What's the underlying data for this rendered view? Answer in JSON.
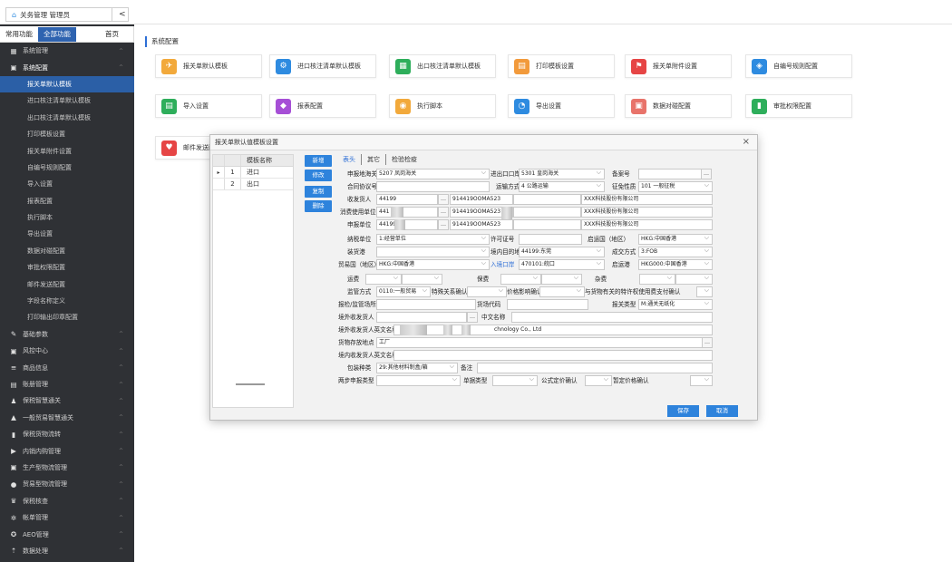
{
  "app": {
    "title": "关务管理 管理员",
    "collapse": "<"
  },
  "sidebar": {
    "tabs": [
      "常用功能",
      "全部功能",
      "首页"
    ],
    "items": [
      {
        "label": "系统管理",
        "icon": "grid-icon",
        "level": 1,
        "chev": "^"
      },
      {
        "label": "系统配置",
        "icon": "checkbox-icon",
        "level": 1,
        "chev": "^",
        "open": true
      },
      {
        "label": "报关单默认模板",
        "level": 2,
        "active": true
      },
      {
        "label": "进口核注清单默认模板",
        "level": 2
      },
      {
        "label": "出口核注清单默认模板",
        "level": 2
      },
      {
        "label": "打印模板设置",
        "level": 2
      },
      {
        "label": "报关单附件设置",
        "level": 2
      },
      {
        "label": "自编号规则配置",
        "level": 2
      },
      {
        "label": "导入设置",
        "level": 2
      },
      {
        "label": "报表配置",
        "level": 2
      },
      {
        "label": "执行脚本",
        "level": 2
      },
      {
        "label": "导出设置",
        "level": 2
      },
      {
        "label": "数据对碰配置",
        "level": 2
      },
      {
        "label": "审批权限配置",
        "level": 2
      },
      {
        "label": "邮件发送配置",
        "level": 2
      },
      {
        "label": "字段名称定义",
        "level": 2
      },
      {
        "label": "打印输出印章配置",
        "level": 2
      },
      {
        "label": "基础参数",
        "icon": "pin-icon",
        "level": 1,
        "chev": "^"
      },
      {
        "label": "风控中心",
        "icon": "checkbox-icon",
        "level": 1,
        "chev": "^"
      },
      {
        "label": "商品信息",
        "icon": "list-icon",
        "level": 1,
        "chev": "^"
      },
      {
        "label": "账册管理",
        "icon": "book-icon",
        "level": 1,
        "chev": "^"
      },
      {
        "label": "保税智慧通关",
        "icon": "user-icon",
        "level": 1,
        "chev": "^"
      },
      {
        "label": "一般贸易智慧通关",
        "icon": "factory-icon",
        "level": 1,
        "chev": "^"
      },
      {
        "label": "保税货物流转",
        "icon": "box-icon",
        "level": 1,
        "chev": "^"
      },
      {
        "label": "内销内购管理",
        "icon": "truck-icon",
        "level": 1,
        "chev": "^"
      },
      {
        "label": "生产型物流管理",
        "icon": "checkbox-icon",
        "level": 1,
        "chev": "^"
      },
      {
        "label": "贸易型物流管理",
        "icon": "circle-icon",
        "level": 1,
        "chev": "^"
      },
      {
        "label": "保税核查",
        "icon": "trophy-icon",
        "level": 1,
        "chev": "^"
      },
      {
        "label": "帐单管理",
        "icon": "gear-icon",
        "level": 1,
        "chev": "^"
      },
      {
        "label": "AEO管理",
        "icon": "shield-icon",
        "level": 1,
        "chev": "^"
      },
      {
        "label": "数据处理",
        "icon": "upload-icon",
        "level": 1,
        "chev": "^"
      }
    ]
  },
  "main": {
    "section": "系统配置",
    "cards": [
      {
        "label": "报关单默认模板",
        "color": "#f2a93b",
        "icon": "plane-icon",
        "glyph": "✈"
      },
      {
        "label": "进口核注清单默认模板",
        "color": "#2e8be0",
        "icon": "share-icon",
        "glyph": "⚙"
      },
      {
        "label": "出口核注清单默认模板",
        "color": "#2eae5b",
        "icon": "grid-icon",
        "glyph": "▦"
      },
      {
        "label": "打印模板设置",
        "color": "#f29a3b",
        "icon": "printer-icon",
        "glyph": "▤"
      },
      {
        "label": "报关单附件设置",
        "color": "#e64545",
        "icon": "flag-icon",
        "glyph": "⚑"
      },
      {
        "label": "自编号规则配置",
        "color": "#2e8be0",
        "icon": "layers-icon",
        "glyph": "◈"
      },
      {
        "label": "导入设置",
        "color": "#2eae5b",
        "icon": "document-icon",
        "glyph": "▤"
      },
      {
        "label": "报表配置",
        "color": "#a64fd6",
        "icon": "tag-icon",
        "glyph": "◆"
      },
      {
        "label": "执行脚本",
        "color": "#f2a93b",
        "icon": "search-user-icon",
        "glyph": "◉"
      },
      {
        "label": "导出设置",
        "color": "#2e8be0",
        "icon": "compass-icon",
        "glyph": "◔"
      },
      {
        "label": "数据对碰配置",
        "color": "#e8736a",
        "icon": "cube-icon",
        "glyph": "▣"
      },
      {
        "label": "审批权限配置",
        "color": "#2eae5b",
        "icon": "book-icon",
        "glyph": "▮"
      },
      {
        "label": "邮件发送配置",
        "color": "#e64545",
        "icon": "heart-icon",
        "glyph": "♥"
      }
    ]
  },
  "dialog": {
    "title": "报关单默认值模板设置",
    "close": "×",
    "list_header": "模板名称",
    "rows": [
      {
        "idx": "1",
        "name": "进口",
        "mark": "▸"
      },
      {
        "idx": "2",
        "name": "出口",
        "mark": ""
      }
    ],
    "buttons": [
      "新增",
      "修改",
      "复制",
      "删除"
    ],
    "tabs": [
      "表头",
      "其它",
      "检验检疫"
    ],
    "save": "保存",
    "cancel": "取消",
    "form": {
      "l_port": "申报地海关",
      "v_port": "5207 凤岗海关",
      "l_ieport": "进出口口岸",
      "v_ieport": "5301 皇岗海关",
      "l_record": "备案号",
      "l_contract": "合同协议号",
      "l_transport": "运输方式",
      "v_transport": "4 公路运输",
      "l_tax": "征免性质",
      "v_tax": "101 一般征税",
      "l_consignee": "收发货人",
      "v_consignee_code": "44199",
      "v_consignee_credit": "914419OOMA523",
      "v_consignee_name": "XXX科技股份有限公司",
      "l_user": "消费使用单位",
      "v_user_code": "441",
      "v_user_credit": "914419OOMA523",
      "v_user_name": "XXX科技股份有限公司",
      "l_declarant": "申报单位",
      "v_declarant_code": "44199",
      "v_declarant_credit": "914419OOMA523",
      "v_declarant_name": "XXX科技股份有限公司",
      "l_taxunit": "纳税单位",
      "v_taxunit": "1:经营单位",
      "l_license": "许可证号",
      "l_origin": "启运国（地区）",
      "v_origin": "HKG:中国香港",
      "l_loadport": "装货港",
      "l_dest": "境内目的地",
      "v_dest": "44199:东莞",
      "l_deal": "成交方式",
      "v_deal": "3:FOB",
      "l_trade": "贸易国（地区）",
      "v_trade": "HKG:中国香港",
      "l_entry": "入境口岸",
      "v_entry": "470101:皖口",
      "l_depport": "启运港",
      "v_depport": "HKG000:中国香港",
      "l_freight": "运费",
      "l_insurance": "保费",
      "l_misc": "杂费",
      "l_supervise": "监管方式",
      "v_supervise": "0110:一般贸易",
      "l_special": "特殊关系确认",
      "l_price": "价格影响确认",
      "l_royalty": "与货物有关的特许权使用费支付确认",
      "l_place": "报检/监管场所",
      "l_goodscode": "货场代码",
      "l_type": "报关类型",
      "v_type": "M:通关无纸化",
      "l_overseas": "境外收发货人",
      "l_cname": "中文名称",
      "l_ename": "境外收发货人英文名称",
      "v_ename": "chnology Co., Ltd",
      "l_storage": "货物存放地点",
      "v_storage": "工厂",
      "l_domestic": "境内收发货人英文名称",
      "l_pack": "包装种类",
      "v_pack": "29:其他材料制盒/箱",
      "l_remark": "备注",
      "l_twostep": "两步申报类型",
      "l_billtype": "单据类型",
      "l_formula": "公式定价确认",
      "l_tentative": "暂定价格确认",
      "ellipsis": "…"
    }
  }
}
